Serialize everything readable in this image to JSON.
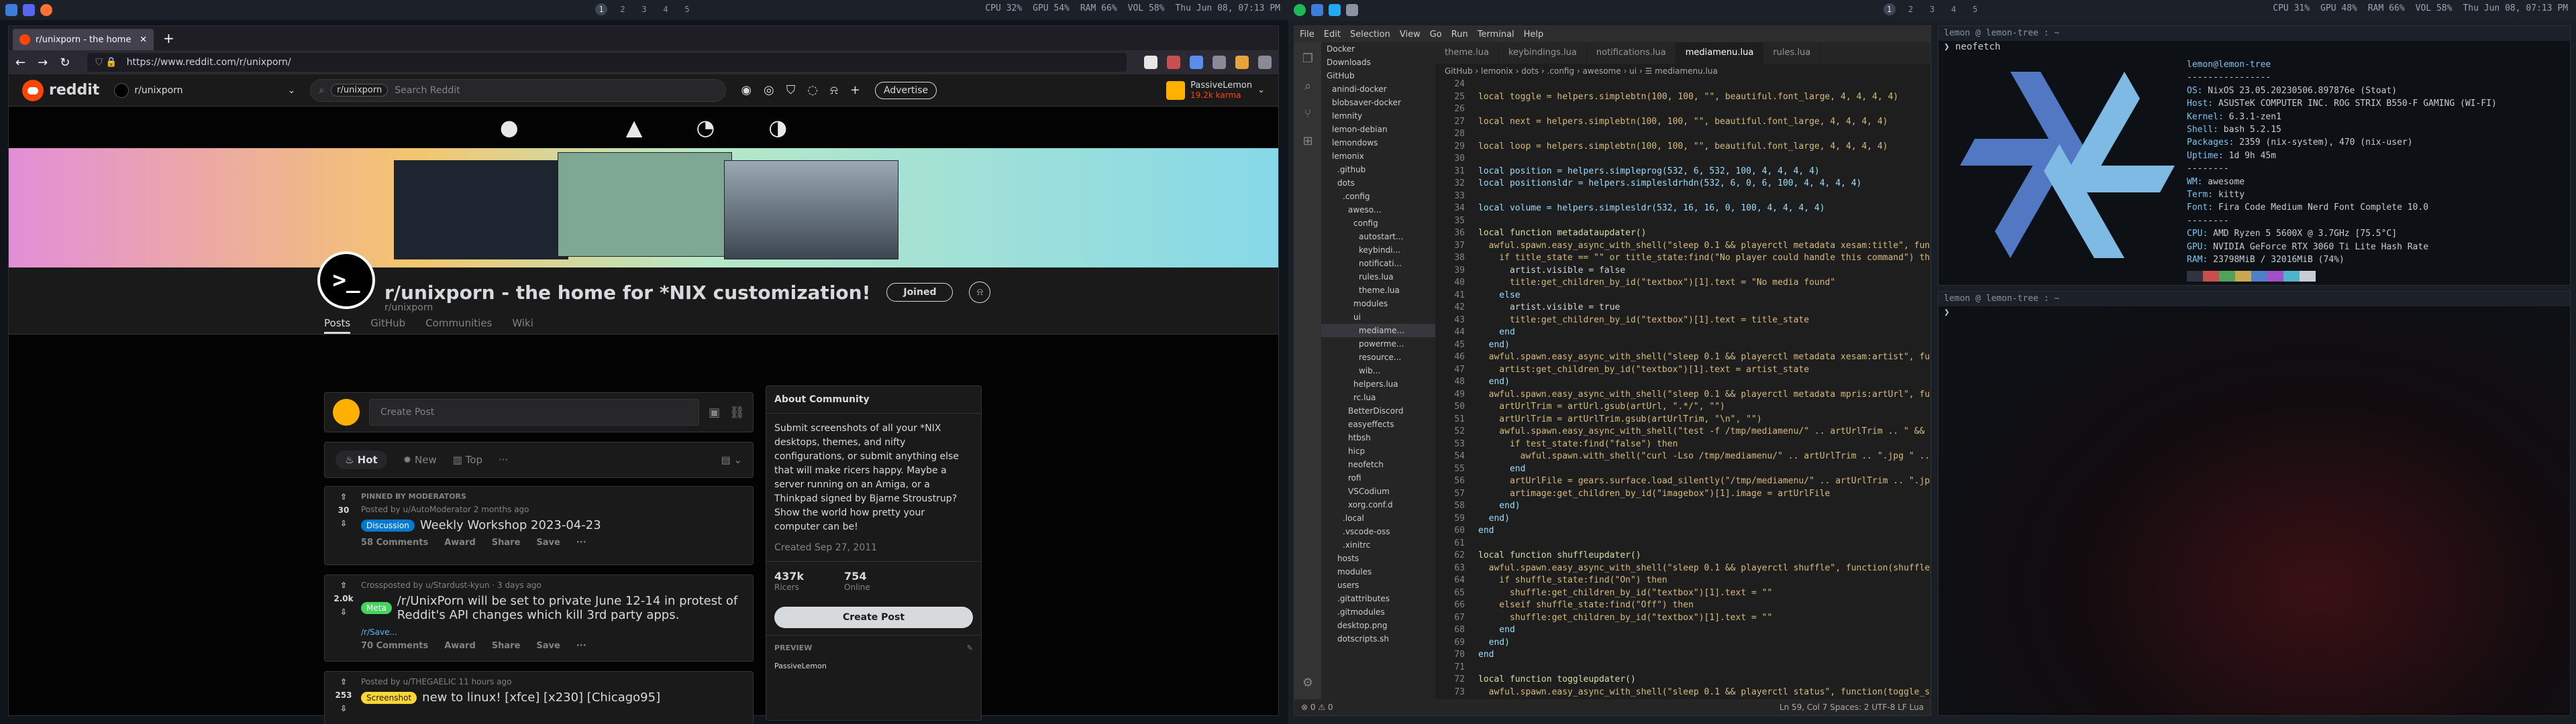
{
  "bars": {
    "left": {
      "workspaces": [
        "1",
        "2",
        "3",
        "4",
        "5"
      ],
      "active": "1",
      "cpu": "CPU 32%",
      "gpu": "GPU 54%",
      "ram": "RAM 66%",
      "vol": "VOL 58%",
      "clock": "Thu Jun 08, 07:13 PM"
    },
    "right": {
      "workspaces": [
        "1",
        "2",
        "3",
        "4",
        "5"
      ],
      "active": "1",
      "cpu": "CPU 31%",
      "gpu": "GPU 48%",
      "ram": "RAM 66%",
      "vol": "VOL 58%",
      "clock": "Thu Jun 08, 07:13 PM"
    }
  },
  "firefox": {
    "tab_title": "r/unixporn - the home for *NIX customization!",
    "new_tab": "+",
    "url": "https://www.reddit.com/r/unixporn/"
  },
  "reddit": {
    "logo": "reddit",
    "subreddit_selector": "r/unixporn",
    "search_chip": "r/unixporn",
    "search_placeholder": "Search Reddit",
    "advertise": "Advertise",
    "user": "PassiveLemon",
    "karma": "19.2k karma",
    "title": "r/unixporn - the home for *NIX customization!",
    "name": "r/unixporn",
    "joined": "Joined",
    "icon_text": ">_",
    "nav": [
      "Posts",
      "GitHub",
      "Communities",
      "Wiki"
    ],
    "create_post_placeholder": "Create Post",
    "sort": {
      "hot": "Hot",
      "new": "New",
      "top": "Top"
    },
    "posts": [
      {
        "pinned": "PINNED BY MODERATORS",
        "votes": "30",
        "meta": "Posted by u/AutoModerator 2 months ago",
        "flair": "Discussion",
        "flair_color": "#0079d3",
        "title": "Weekly Workshop 2023-04-23",
        "comments": "58 Comments",
        "award": "Award",
        "share": "Share",
        "save": "Save"
      },
      {
        "votes": "2.0k",
        "meta": "Crossposted by u/Stardust-kyun · 3 days ago",
        "flair": "Meta",
        "flair_color": "#46d160",
        "title": "/r/UnixPorn will be set to private June 12-14 in protest of Reddit's API changes which kill 3rd party apps.",
        "link": "/r/Save...",
        "comments": "70 Comments",
        "award": "Award",
        "share": "Share",
        "save": "Save"
      },
      {
        "votes": "253",
        "meta": "Posted by u/THEGAELIC 11 hours ago",
        "flair": "Screenshot",
        "flair_color": "#ffd635",
        "title": "new to linux! [xfce] [x230] [Chicago95]"
      }
    ],
    "about": {
      "heading": "About Community",
      "body": "Submit screenshots of all your *NIX desktops, themes, and nifty configurations, or submit anything else that will make ricers happy. Maybe a server running on an Amiga, or a Thinkpad signed by Bjarne Stroustrup? Show the world how pretty your computer can be!",
      "created": "Created Sep 27, 2011",
      "readers": "437k",
      "readers_label": "Ricers",
      "online": "754",
      "online_label": "Online",
      "create": "Create Post",
      "preview": "PREVIEW",
      "preview_user": "PassiveLemon"
    }
  },
  "vscode": {
    "menu": [
      "File",
      "Edit",
      "Selection",
      "View",
      "Go",
      "Run",
      "Terminal",
      "Help"
    ],
    "tabs": [
      "theme.lua",
      "keybindings.lua",
      "notifications.lua",
      "mediamenu.lua",
      "rules.lua"
    ],
    "active_tab": "mediamenu.lua",
    "breadcrumb": "GitHub › lemonix › dots › .config › awesome › ui › ☰ mediamenu.lua",
    "tree": [
      "Docker",
      "Downloads",
      "GitHub",
      "anindi-docker",
      "blobsaver-docker",
      "lemnity",
      "lemon-debian",
      "lemondows",
      "lemonix",
      ".github",
      "dots",
      ".config",
      "aweso...",
      "config",
      "autostart...",
      "keybindi...",
      "notificati...",
      "rules.lua",
      "theme.lua",
      "modules",
      "ui",
      "mediame...",
      "powerme...",
      "resource...",
      "wib...",
      "helpers.lua",
      "rc.lua",
      "BetterDiscord",
      "easyeffects",
      "htbsh",
      "hicp",
      "neofetch",
      "rofi",
      "VSCodium",
      "xorg.conf.d",
      ".local",
      ".vscode-oss",
      ".xinitrc",
      "hosts",
      "modules",
      "users",
      ".gitattributes",
      ".gitmodules",
      "desktop.png",
      "dotscripts.sh"
    ],
    "status_left": "⊗ 0 ⚠ 0",
    "status_right": "Ln 59, Col 7   Spaces: 2   UTF-8   LF   Lua",
    "code": [
      [
        "24",
        ""
      ],
      [
        "25",
        "local toggle = helpers.simplebtn(100, 100, \"\", beautiful.font_large, 4, 4, 4, 4)"
      ],
      [
        "26",
        ""
      ],
      [
        "27",
        "local next = helpers.simplebtn(100, 100, \"\", beautiful.font_large, 4, 4, 4, 4)"
      ],
      [
        "28",
        ""
      ],
      [
        "29",
        "local loop = helpers.simplebtn(100, 100, \"\", beautiful.font_large, 4, 4, 4, 4)"
      ],
      [
        "30",
        ""
      ],
      [
        "31",
        "local position = helpers.simpleprog(532, 6, 532, 100, 4, 4, 4, 4)"
      ],
      [
        "32",
        "local positionsldr = helpers.simplesldrhdn(532, 6, 0, 6, 100, 4, 4, 4, 4)"
      ],
      [
        "33",
        ""
      ],
      [
        "34",
        "local volume = helpers.simplesldr(532, 16, 16, 0, 100, 4, 4, 4, 4)"
      ],
      [
        "35",
        ""
      ],
      [
        "36",
        "local function metadataupdater()"
      ],
      [
        "37",
        "  awful.spawn.easy_async_with_shell(\"sleep 0.1 && playerctl metadata xesam:title\", function(title_state)"
      ],
      [
        "38",
        "    if title_state == \"\" or title_state:find(\"No player could handle this command\") then"
      ],
      [
        "39",
        "      artist.visible = false"
      ],
      [
        "40",
        "      title:get_children_by_id(\"textbox\")[1].text = \"No media found\""
      ],
      [
        "41",
        "    else"
      ],
      [
        "42",
        "      artist.visible = true"
      ],
      [
        "43",
        "      title:get_children_by_id(\"textbox\")[1].text = title_state"
      ],
      [
        "44",
        "    end"
      ],
      [
        "45",
        "  end)"
      ],
      [
        "46",
        "  awful.spawn.easy_async_with_shell(\"sleep 0.1 && playerctl metadata xesam:artist\", function(artist_state)"
      ],
      [
        "47",
        "    artist:get_children_by_id(\"textbox\")[1].text = artist_state"
      ],
      [
        "48",
        "  end)"
      ],
      [
        "49",
        "  awful.spawn.easy_async_with_shell(\"sleep 0.1 && playerctl metadata mpris:artUrl\", function(artUrl)"
      ],
      [
        "50",
        "    artUrlTrim = artUrl.gsub(artUrl, \".*/\", \"\")"
      ],
      [
        "51",
        "    artUrlTrim = artUrlTrim.gsub(artUrlTrim, \"\\n\", \"\")"
      ],
      [
        "52",
        "    awful.spawn.easy_async_with_shell(\"test -f /tmp/mediamenu/\" .. artUrlTrim .. \" && echo true || echo false\", function(test)"
      ],
      [
        "53",
        "      if test_state:find(\"false\") then"
      ],
      [
        "54",
        "        awful.spawn.with_shell(\"curl -Lso /tmp/mediamenu/\" .. artUrlTrim .. \".jpg \" .. artUrl)"
      ],
      [
        "55",
        "      end"
      ],
      [
        "56",
        "      artUrlFile = gears.surface.load_silently(\"/tmp/mediamenu/\" .. artUrlTrim .. \".jpg\")"
      ],
      [
        "57",
        "      artimage:get_children_by_id(\"imagebox\")[1].image = artUrlFile"
      ],
      [
        "58",
        "    end)"
      ],
      [
        "59",
        "  end)"
      ],
      [
        "60",
        "end"
      ],
      [
        "61",
        ""
      ],
      [
        "62",
        "local function shuffleupdater()"
      ],
      [
        "63",
        "  awful.spawn.easy_async_with_shell(\"sleep 0.1 && playerctl shuffle\", function(shuffle_state)"
      ],
      [
        "64",
        "    if shuffle_state:find(\"On\") then"
      ],
      [
        "65",
        "      shuffle:get_children_by_id(\"textbox\")[1].text = \"\""
      ],
      [
        "66",
        "    elseif shuffle_state:find(\"Off\") then"
      ],
      [
        "67",
        "      shuffle:get_children_by_id(\"textbox\")[1].text = \"\""
      ],
      [
        "68",
        "    end"
      ],
      [
        "69",
        "  end)"
      ],
      [
        "70",
        "end"
      ],
      [
        "71",
        ""
      ],
      [
        "72",
        "local function toggleupdater()"
      ],
      [
        "73",
        "  awful.spawn.easy_async_with_shell(\"sleep 0.1 && playerctl status\", function(toggle_state)"
      ],
      [
        "74",
        "    if toggle_state:find(\"Playing\") then"
      ]
    ]
  },
  "terminal1": {
    "title": "lemon @ lemon-tree : ~",
    "prompt": "❯ neofetch",
    "info": [
      {
        "k": "",
        "v": "lemon@lemon-tree"
      },
      {
        "k": "",
        "v": "----------------"
      },
      {
        "k": "OS:",
        "v": " NixOS 23.05.20230506.897876e (Stoat)"
      },
      {
        "k": "Host:",
        "v": " ASUSTeK COMPUTER INC. ROG STRIX B550-F GAMING (WI-FI)"
      },
      {
        "k": "Kernel:",
        "v": " 6.3.1-zen1"
      },
      {
        "k": "Shell:",
        "v": " bash 5.2.15"
      },
      {
        "k": "Packages:",
        "v": " 2359 (nix-system), 470 (nix-user)"
      },
      {
        "k": "Uptime:",
        "v": " 1d 9h 45m"
      },
      {
        "k": "",
        "v": "--------"
      },
      {
        "k": "WM:",
        "v": " awesome"
      },
      {
        "k": "Term:",
        "v": " kitty"
      },
      {
        "k": "Font:",
        "v": " Fira Code Medium Nerd Font Complete 10.0"
      },
      {
        "k": "",
        "v": "--------"
      },
      {
        "k": "CPU:",
        "v": " AMD Ryzen 5 5600X @ 3.7GHz [75.5°C]"
      },
      {
        "k": "GPU:",
        "v": " NVIDIA GeForce RTX 3060 Ti Lite Hash Rate"
      },
      {
        "k": "RAM:",
        "v": " 23798MiB / 32016MiB (74%)"
      }
    ],
    "swatches": [
      "#2f343f",
      "#c94f4f",
      "#4fa35a",
      "#c9a84f",
      "#4f7fc9",
      "#a34fc9",
      "#4fb3c9",
      "#c8cdd4"
    ]
  },
  "terminal2": {
    "title": "lemon @ lemon-tree : ~",
    "prompt": "❯ "
  }
}
